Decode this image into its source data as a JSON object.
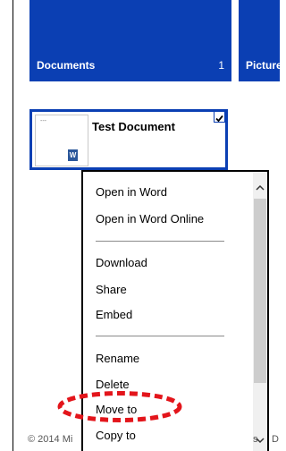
{
  "tiles": [
    {
      "label": "Documents",
      "count": "1"
    },
    {
      "label": "Pictures"
    }
  ],
  "file": {
    "name": "Test Document",
    "thumbnail_dots": "---",
    "type_icon_letter": "W",
    "selected": true
  },
  "context_menu": {
    "items": [
      {
        "label": "Open in Word"
      },
      {
        "label": "Open in Word Online"
      },
      {
        "label": "Download"
      },
      {
        "label": "Share"
      },
      {
        "label": "Embed"
      },
      {
        "label": "Rename"
      },
      {
        "label": "Delete"
      },
      {
        "label": "Move to",
        "highlighted": true
      },
      {
        "label": "Copy to"
      }
    ]
  },
  "footer": {
    "copyright": "© 2014 Mi",
    "fragment_1": "s",
    "fragment_2": "D"
  },
  "colors": {
    "tile_blue": "#0b3fb3",
    "highlight_red": "#e3151b"
  }
}
